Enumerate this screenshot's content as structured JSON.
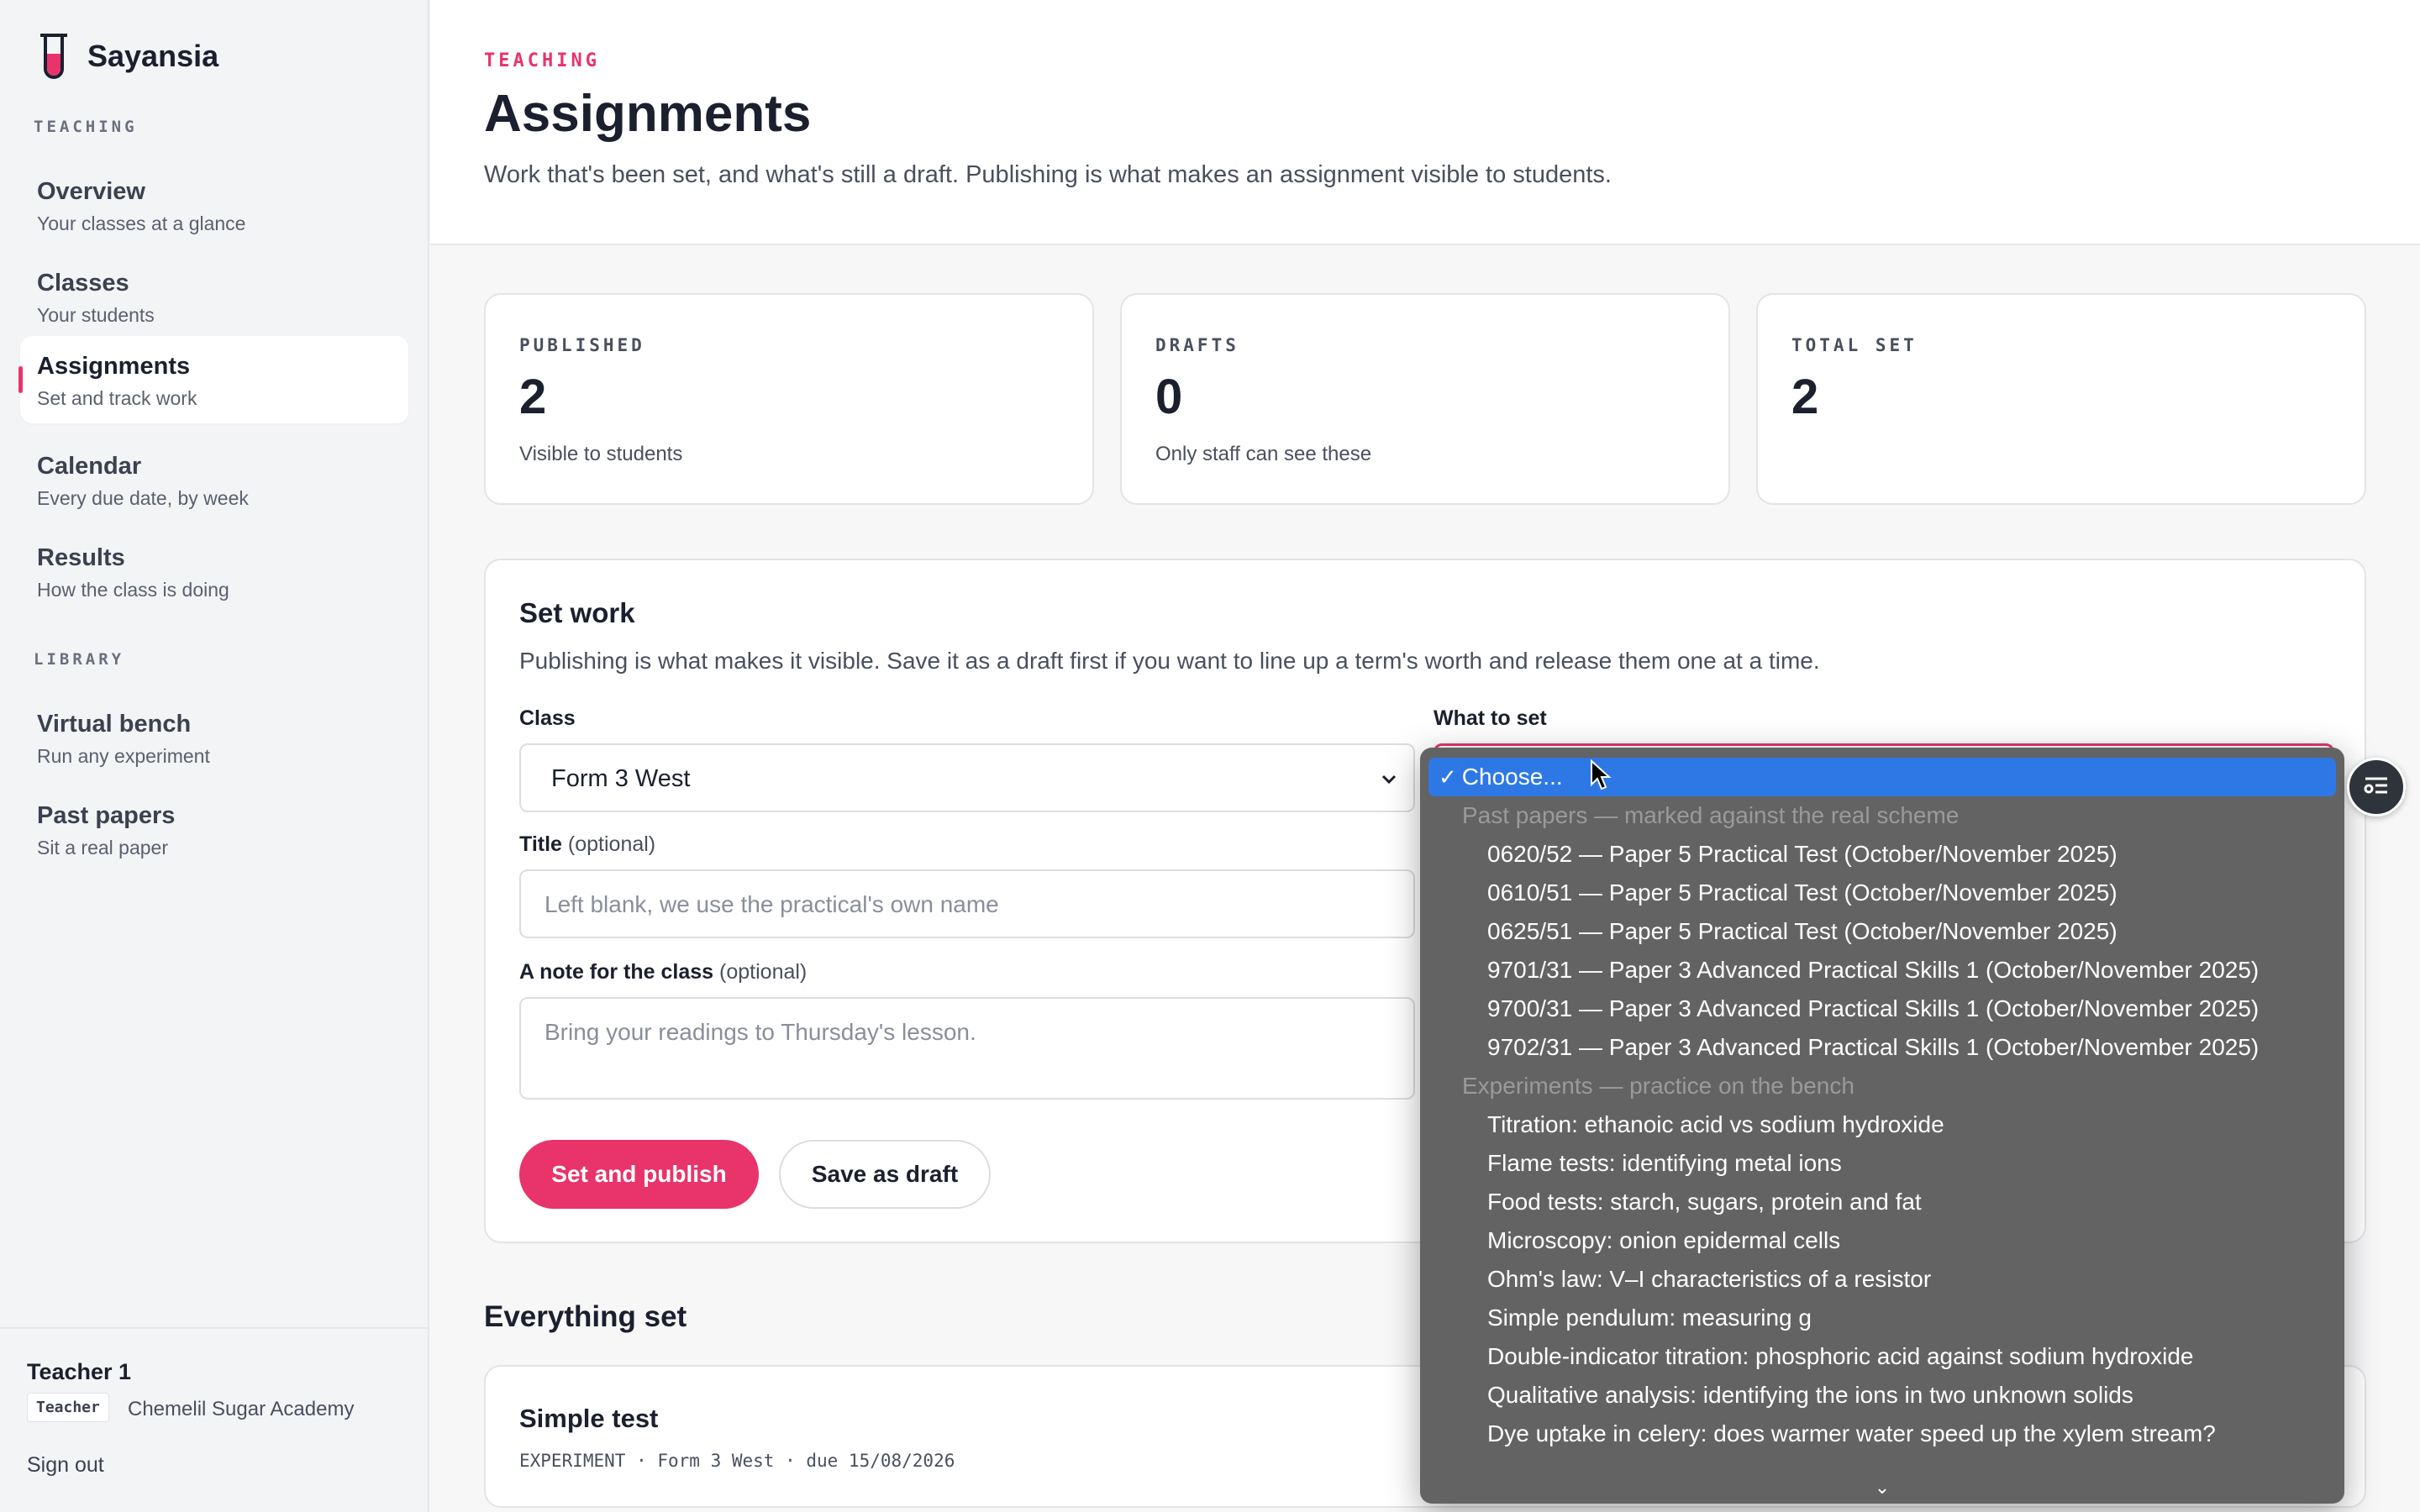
{
  "app": {
    "name": "Sayansia"
  },
  "sidebar": {
    "sections": [
      {
        "label": "TEACHING"
      },
      {
        "label": "LIBRARY"
      }
    ],
    "items": [
      {
        "title": "Overview",
        "subtitle": "Your classes at a glance"
      },
      {
        "title": "Classes",
        "subtitle": "Your students"
      },
      {
        "title": "Assignments",
        "subtitle": "Set and track work",
        "active": true
      },
      {
        "title": "Calendar",
        "subtitle": "Every due date, by week"
      },
      {
        "title": "Results",
        "subtitle": "How the class is doing"
      },
      {
        "title": "Virtual bench",
        "subtitle": "Run any experiment"
      },
      {
        "title": "Past papers",
        "subtitle": "Sit a real paper"
      }
    ],
    "user": {
      "name": "Teacher 1",
      "role": "Teacher",
      "school": "Chemelil Sugar Academy",
      "signout": "Sign out"
    }
  },
  "header": {
    "eyebrow": "TEACHING",
    "title": "Assignments",
    "description": "Work that's been set, and what's still a draft. Publishing is what makes an assignment visible to students."
  },
  "stats": [
    {
      "label": "PUBLISHED",
      "value": "2",
      "sub": "Visible to students"
    },
    {
      "label": "DRAFTS",
      "value": "0",
      "sub": "Only staff can see these"
    },
    {
      "label": "TOTAL SET",
      "value": "2",
      "sub": ""
    }
  ],
  "form": {
    "title": "Set work",
    "description": "Publishing is what makes it visible. Save it as a draft first if you want to line up a term's worth and release them one at a time.",
    "class_label": "Class",
    "class_value": "Form 3 West",
    "what_label": "What to set",
    "title_label": "Title",
    "title_optional": "(optional)",
    "title_placeholder": "Left blank, we use the practical's own name",
    "note_label": "A note for the class",
    "note_optional": "(optional)",
    "note_placeholder": "Bring your readings to Thursday's lesson.",
    "publish_button": "Set and publish",
    "draft_button": "Save as draft"
  },
  "dropdown": {
    "selected": "Choose...",
    "groups": [
      {
        "label": "Past papers — marked against the real scheme",
        "options": [
          "0620/52 — Paper 5 Practical Test (October/November 2025)",
          "0610/51 — Paper 5 Practical Test (October/November 2025)",
          "0625/51 — Paper 5 Practical Test (October/November 2025)",
          "9701/31 — Paper 3 Advanced Practical Skills 1 (October/November 2025)",
          "9700/31 — Paper 3 Advanced Practical Skills 1 (October/November 2025)",
          "9702/31 — Paper 3 Advanced Practical Skills 1 (October/November 2025)"
        ]
      },
      {
        "label": "Experiments — practice on the bench",
        "options": [
          "Titration: ethanoic acid vs sodium hydroxide",
          "Flame tests: identifying metal ions",
          "Food tests: starch, sugars, protein and fat",
          "Microscopy: onion epidermal cells",
          "Ohm's law: V–I characteristics of a resistor",
          "Simple pendulum: measuring g",
          "Double-indicator titration: phosphoric acid against sodium hydroxide",
          "Qualitative analysis: identifying the ions in two unknown solids",
          "Dye uptake in celery: does warmer water speed up the xylem stream?"
        ]
      }
    ]
  },
  "everything_set": {
    "title": "Everything set",
    "items": [
      {
        "title": "Simple test",
        "meta": "EXPERIMENT · Form 3 West · due 15/08/2026"
      }
    ]
  },
  "colors": {
    "accent": "#e8336b",
    "select_highlight": "#2e78e6",
    "menu_bg": "#636363"
  }
}
